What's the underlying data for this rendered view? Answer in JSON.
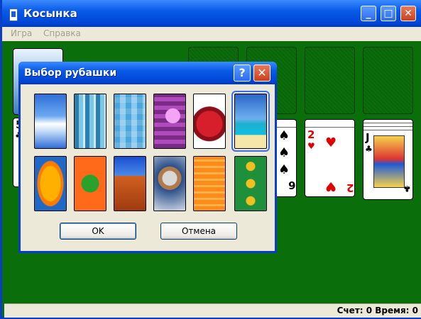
{
  "window": {
    "title": "Косынка"
  },
  "menu": {
    "items": [
      "Игра",
      "Справка"
    ]
  },
  "status": {
    "score_text": "Счет: 0 Время: 0"
  },
  "cards": {
    "left_partial": {
      "rank": "5",
      "suit": "♣"
    },
    "col_six": {
      "rank": "6",
      "suit": "♠"
    },
    "col_two": {
      "rank": "2",
      "suit": "♥"
    },
    "col_jack": {
      "rank": "J",
      "suit": "♣"
    }
  },
  "dialog": {
    "title": "Выбор рубашки",
    "ok_label": "OK",
    "cancel_label": "Отмена",
    "help_glyph": "?",
    "close_glyph": "✕",
    "backs": [
      {
        "name": "clouds"
      },
      {
        "name": "blue-stripes"
      },
      {
        "name": "blue-squares"
      },
      {
        "name": "purple-squares"
      },
      {
        "name": "red-rose"
      },
      {
        "name": "palm-beach"
      },
      {
        "name": "fish"
      },
      {
        "name": "frog"
      },
      {
        "name": "desert"
      },
      {
        "name": "astronaut"
      },
      {
        "name": "orange-lines"
      },
      {
        "name": "cars"
      }
    ],
    "selected_back": 5
  }
}
